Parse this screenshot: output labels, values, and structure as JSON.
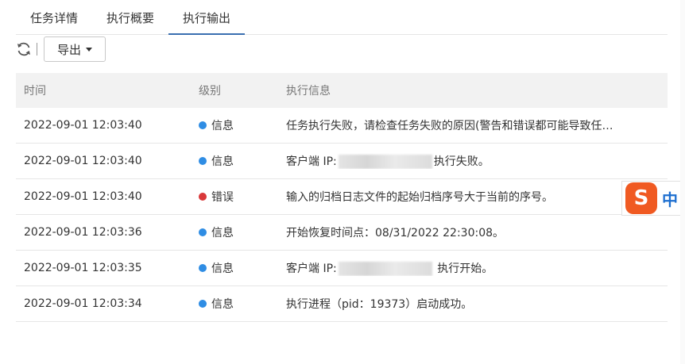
{
  "tabs": [
    {
      "label": "任务详情"
    },
    {
      "label": "执行概要"
    },
    {
      "label": "执行输出"
    }
  ],
  "toolbar": {
    "export_label": "导出"
  },
  "table": {
    "headers": {
      "time": "时间",
      "level": "级别",
      "message": "执行信息"
    },
    "rows": [
      {
        "time": "2022-09-01 12:03:40",
        "level": "信息",
        "level_color": "#2f8de4",
        "msg": "任务执行失败，请检查任务失败的原因(警告和错误都可能导致任…"
      },
      {
        "time": "2022-09-01 12:03:40",
        "level": "信息",
        "level_color": "#2f8de4",
        "msg_prefix": "客户端 IP:",
        "msg_suffix": "执行失败。"
      },
      {
        "time": "2022-09-01 12:03:40",
        "level": "错误",
        "level_color": "#d9383a",
        "msg": "输入的归档日志文件的起始归档序号大于当前的序号。"
      },
      {
        "time": "2022-09-01 12:03:36",
        "level": "信息",
        "level_color": "#2f8de4",
        "msg": "开始恢复时间点：08/31/2022 22:30:08。"
      },
      {
        "time": "2022-09-01 12:03:35",
        "level": "信息",
        "level_color": "#2f8de4",
        "msg_prefix": "客户端 IP:",
        "msg_suffix": " 执行开始。"
      },
      {
        "time": "2022-09-01 12:03:34",
        "level": "信息",
        "level_color": "#2f8de4",
        "msg": "执行进程（pid：19373）启动成功。"
      }
    ]
  },
  "ime": {
    "logo": "S",
    "mode": "中"
  },
  "colors": {
    "accent": "#3a6fb0",
    "info": "#2f8de4",
    "error": "#d9383a"
  }
}
